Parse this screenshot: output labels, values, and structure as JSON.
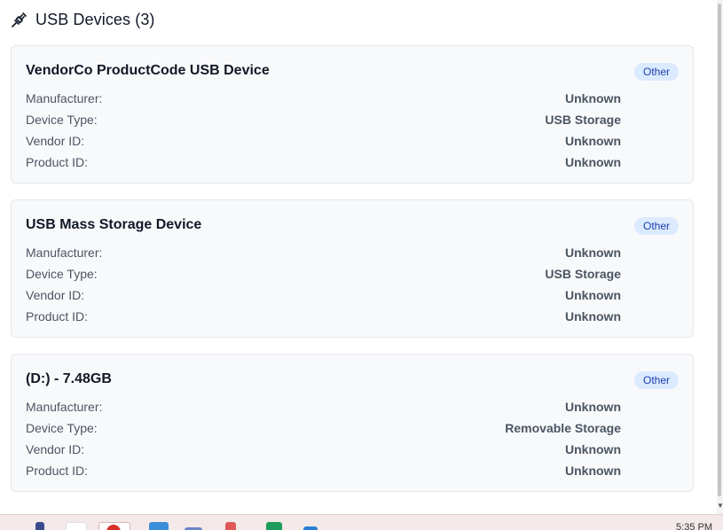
{
  "section": {
    "title": "USB Devices (3)",
    "icon": "usb-plug-icon"
  },
  "devices": [
    {
      "name": "VendorCo ProductCode USB Device",
      "badge": "Other",
      "fields": [
        {
          "label": "Manufacturer:",
          "value": "Unknown"
        },
        {
          "label": "Device Type:",
          "value": "USB Storage"
        },
        {
          "label": "Vendor ID:",
          "value": "Unknown"
        },
        {
          "label": "Product ID:",
          "value": "Unknown"
        }
      ]
    },
    {
      "name": "USB Mass Storage Device",
      "badge": "Other",
      "fields": [
        {
          "label": "Manufacturer:",
          "value": "Unknown"
        },
        {
          "label": "Device Type:",
          "value": "USB Storage"
        },
        {
          "label": "Vendor ID:",
          "value": "Unknown"
        },
        {
          "label": "Product ID:",
          "value": "Unknown"
        }
      ]
    },
    {
      "name": "(D:) - 7.48GB",
      "badge": "Other",
      "fields": [
        {
          "label": "Manufacturer:",
          "value": "Unknown"
        },
        {
          "label": "Device Type:",
          "value": "Removable Storage"
        },
        {
          "label": "Vendor ID:",
          "value": "Unknown"
        },
        {
          "label": "Product ID:",
          "value": "Unknown"
        }
      ]
    }
  ],
  "taskbar": {
    "clock": "5:35 PM"
  },
  "colors": {
    "badge_bg": "#dbeafe",
    "badge_text": "#1e40af",
    "card_bg": "#f8f9fb",
    "taskbar_bg": "#f4e9e9"
  }
}
